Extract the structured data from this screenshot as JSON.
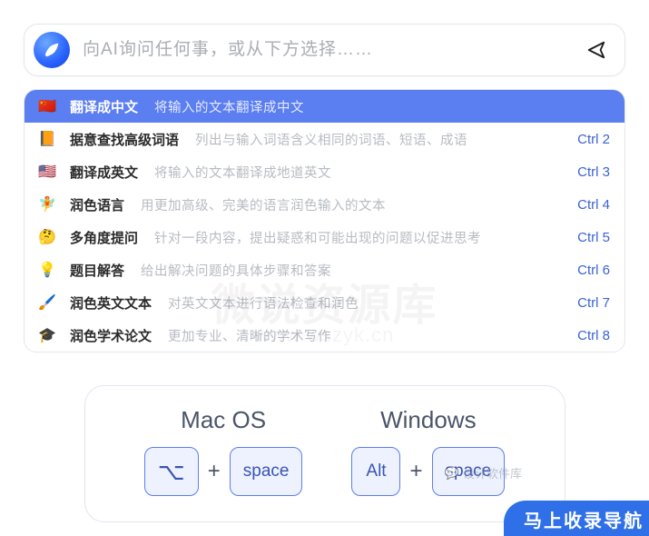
{
  "search": {
    "placeholder": "向AI询问任何事，或从下方选择……"
  },
  "watermark": {
    "line1": "微说资源库",
    "line2": "www.wszyk.cn"
  },
  "commands": [
    {
      "emoji": "🇨🇳",
      "title": "翻译成中文",
      "desc": "将输入的文本翻译成中文",
      "shortcut": "",
      "selected": true
    },
    {
      "emoji": "📙",
      "title": "据意查找高级词语",
      "desc": "列出与输入词语含义相同的词语、短语、成语",
      "shortcut": "Ctrl 2",
      "selected": false
    },
    {
      "emoji": "🇺🇸",
      "title": "翻译成英文",
      "desc": "将输入的文本翻译成地道英文",
      "shortcut": "Ctrl 3",
      "selected": false
    },
    {
      "emoji": "🧚",
      "title": "润色语言",
      "desc": "用更加高级、完美的语言润色输入的文本",
      "shortcut": "Ctrl 4",
      "selected": false
    },
    {
      "emoji": "🤔",
      "title": "多角度提问",
      "desc": "针对一段内容，提出疑惑和可能出现的问题以促进思考",
      "shortcut": "Ctrl 5",
      "selected": false
    },
    {
      "emoji": "💡",
      "title": "题目解答",
      "desc": "给出解决问题的具体步骤和答案",
      "shortcut": "Ctrl 6",
      "selected": false
    },
    {
      "emoji": "🖌️",
      "title": "润色英文文本",
      "desc": "对英文文本进行语法检查和润色",
      "shortcut": "Ctrl 7",
      "selected": false
    },
    {
      "emoji": "🎓",
      "title": "润色学术论文",
      "desc": "更加专业、清晰的学术写作",
      "shortcut": "Ctrl 8",
      "selected": false
    }
  ],
  "hotkeys": {
    "mac": {
      "label": "Mac OS",
      "key1": "⌥",
      "key2": "space"
    },
    "windows": {
      "label": "Windows",
      "key1": "Alt",
      "key2": "space"
    },
    "plus": "+"
  },
  "mini_watermark": "设计软件库",
  "corner_badge": "马上收录导航"
}
